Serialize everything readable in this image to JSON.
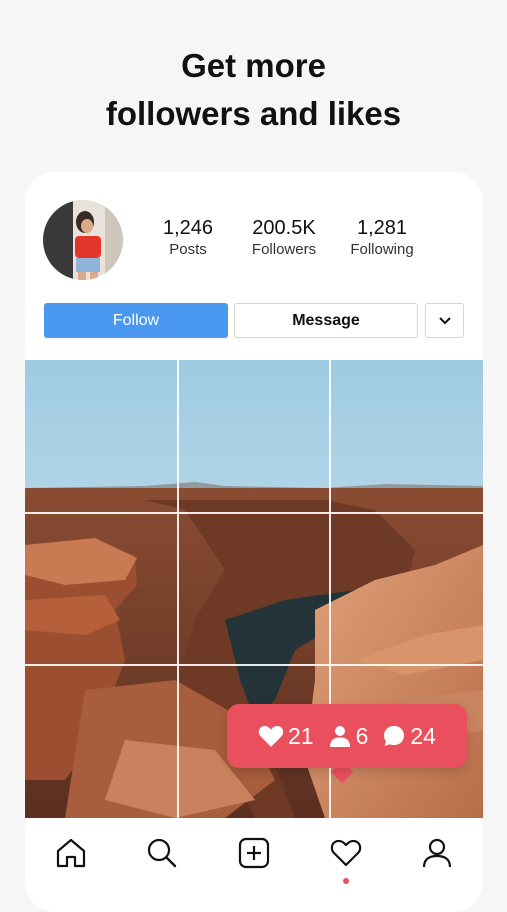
{
  "headline": {
    "line1": "Get more",
    "line2": "followers and likes"
  },
  "profile": {
    "avatar_icon": "profile-photo",
    "stats": [
      {
        "value": "1,246",
        "label": "Posts"
      },
      {
        "value": "200.5K",
        "label": "Followers"
      },
      {
        "value": "1,281",
        "label": "Following"
      }
    ]
  },
  "actions": {
    "follow_label": "Follow",
    "message_label": "Message",
    "more_icon": "chevron-down-icon"
  },
  "photo": {
    "subject": "canyon-landscape"
  },
  "notification": {
    "likes": "21",
    "followers": "6",
    "comments": "24",
    "color": "#ea4f5e"
  },
  "tabbar": {
    "items": [
      "home-icon",
      "search-icon",
      "add-post-icon",
      "heart-icon",
      "profile-icon"
    ],
    "active_indicator_color": "#ea4f5e"
  },
  "colors": {
    "accent": "#4a97f0",
    "background": "#f6f6f6"
  }
}
